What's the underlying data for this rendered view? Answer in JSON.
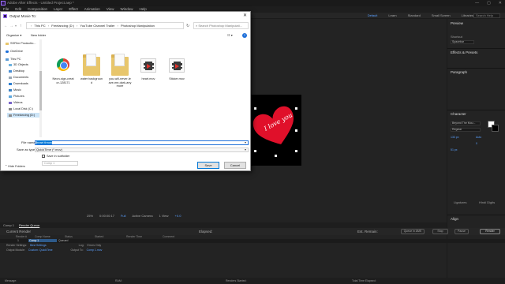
{
  "colors": {
    "ae_bg": "#232323",
    "accent_blue": "#5aa0ff",
    "heart_red": "#e0102a",
    "dialog_bg": "#ffffff",
    "selection_blue": "#0078d7"
  },
  "ae": {
    "title": "Adobe After Effects - Untitled Project.aep *",
    "menu": [
      "File",
      "Edit",
      "Composition",
      "Layer",
      "Effect",
      "Animation",
      "View",
      "Window",
      "Help"
    ],
    "workspaces": [
      "Default",
      "Learn",
      "Standard",
      "Small Screen",
      "Libraries"
    ],
    "active_workspace": "Default",
    "search_placeholder": "Search Help",
    "viewer": {
      "heart_text": "I love you",
      "zoom": "25%",
      "timecode": "0:00:00:17",
      "resolution": "Full",
      "camera": "Active Camera",
      "views": "1 View",
      "exposure": "+0.0"
    },
    "right_panel": {
      "preview": "Preview",
      "shortcut_label": "Shortcut",
      "shortcut_value": "Spacebar",
      "effects_presets": "Effects & Presets",
      "paragraph": "Paragraph",
      "character": "Character",
      "font": "Beyond The Mou...",
      "style": "Regular",
      "size": "133 px",
      "leading": "Auto",
      "tracking": "0",
      "stroke": "51 px",
      "ligatures": "Ligatures",
      "hindi_digits": "Hindi Digits",
      "align": "Align"
    },
    "tabs": [
      "Comp 1",
      "Render Queue"
    ],
    "render_queue": {
      "current_render": "Current Render",
      "elapsed": "Elapsed:",
      "est_remain": "Est. Remain:",
      "queue_ame": "Queue in AME",
      "stop": "Stop",
      "pause": "Pause",
      "render": "Render",
      "columns": [
        "Render",
        "#",
        "Comp Name",
        "Status",
        "Started",
        "Render Time",
        "Comment"
      ],
      "row": {
        "num": "1",
        "comp": "Comp 1",
        "status": "Queued"
      },
      "render_settings_label": "Render Settings:",
      "render_settings_value": "Best Settings",
      "log_label": "Log:",
      "log_value": "Errors Only",
      "output_module_label": "Output Module:",
      "output_module_value": "Custom: QuickTime",
      "output_to_label": "Output To:",
      "output_to_value": "Comp 1.mov"
    },
    "status_bar": [
      "Message:",
      "RAM:",
      "Renders Started:",
      "Total Time Elapsed:"
    ]
  },
  "dialog": {
    "title": "Output Movie To:",
    "close": "✕",
    "breadcrumb": [
      "This PC",
      "Freelancing (D:)",
      "YouTube Channel Trailer",
      "Photoshop Manipulation"
    ],
    "search_placeholder": "Search Photoshop Manipulati...",
    "organize": "Organize ▾",
    "new_folder": "New folder",
    "nav_items": [
      "SSFilm Productio...",
      "OneDrive",
      "This PC",
      "3D Objects",
      "Desktop",
      "Documents",
      "Downloads",
      "Music",
      "Pictures",
      "Videos",
      "Local Disk (C:)",
      "Freelancing (D:)"
    ],
    "files": [
      {
        "name": "Neon-sign-creat\nor-128171",
        "type": "chrome"
      },
      {
        "name": "water backgroun\nd",
        "type": "folder"
      },
      {
        "name": "you-will-never-le\nave-me-dark-any\nmore",
        "type": "folder"
      },
      {
        "name": "heart.mov",
        "type": "movie"
      },
      {
        "name": "Sticker.mov",
        "type": "movie"
      }
    ],
    "file_name_label": "File name:",
    "file_name_value": "heart throw",
    "save_as_label": "Save as type:",
    "save_as_value": "QuickTime (*.mov)",
    "subfolder_label": "Save in subfolder",
    "comp_field": "Comp 1",
    "hide_folders": "Hide Folders",
    "save": "Save",
    "cancel": "Cancel"
  }
}
